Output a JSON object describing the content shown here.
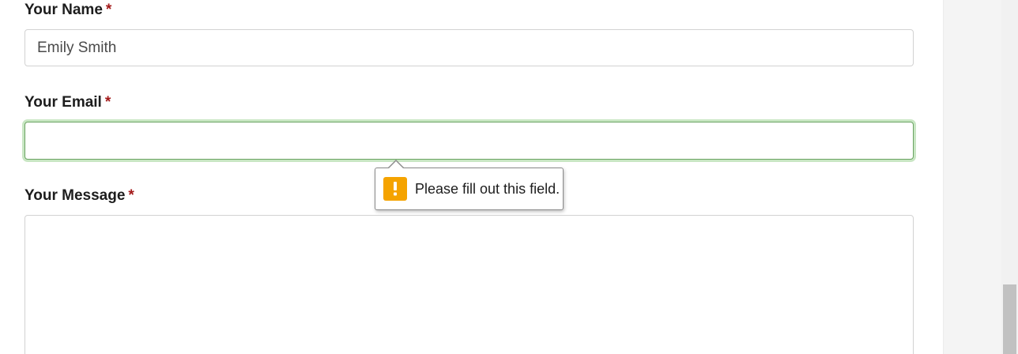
{
  "form": {
    "name": {
      "label": "Your Name",
      "required_mark": "*",
      "value": "Emily Smith"
    },
    "email": {
      "label": "Your Email",
      "required_mark": "*",
      "value": ""
    },
    "message": {
      "label": "Your Message",
      "required_mark": "*",
      "value": ""
    }
  },
  "validation_tooltip": {
    "icon": "warning-icon",
    "text": "Please fill out this field."
  },
  "colors": {
    "required": "#a31919",
    "focus_border": "#6aa362",
    "focus_glow": "#c8e6c3",
    "warning": "#f5a300"
  }
}
